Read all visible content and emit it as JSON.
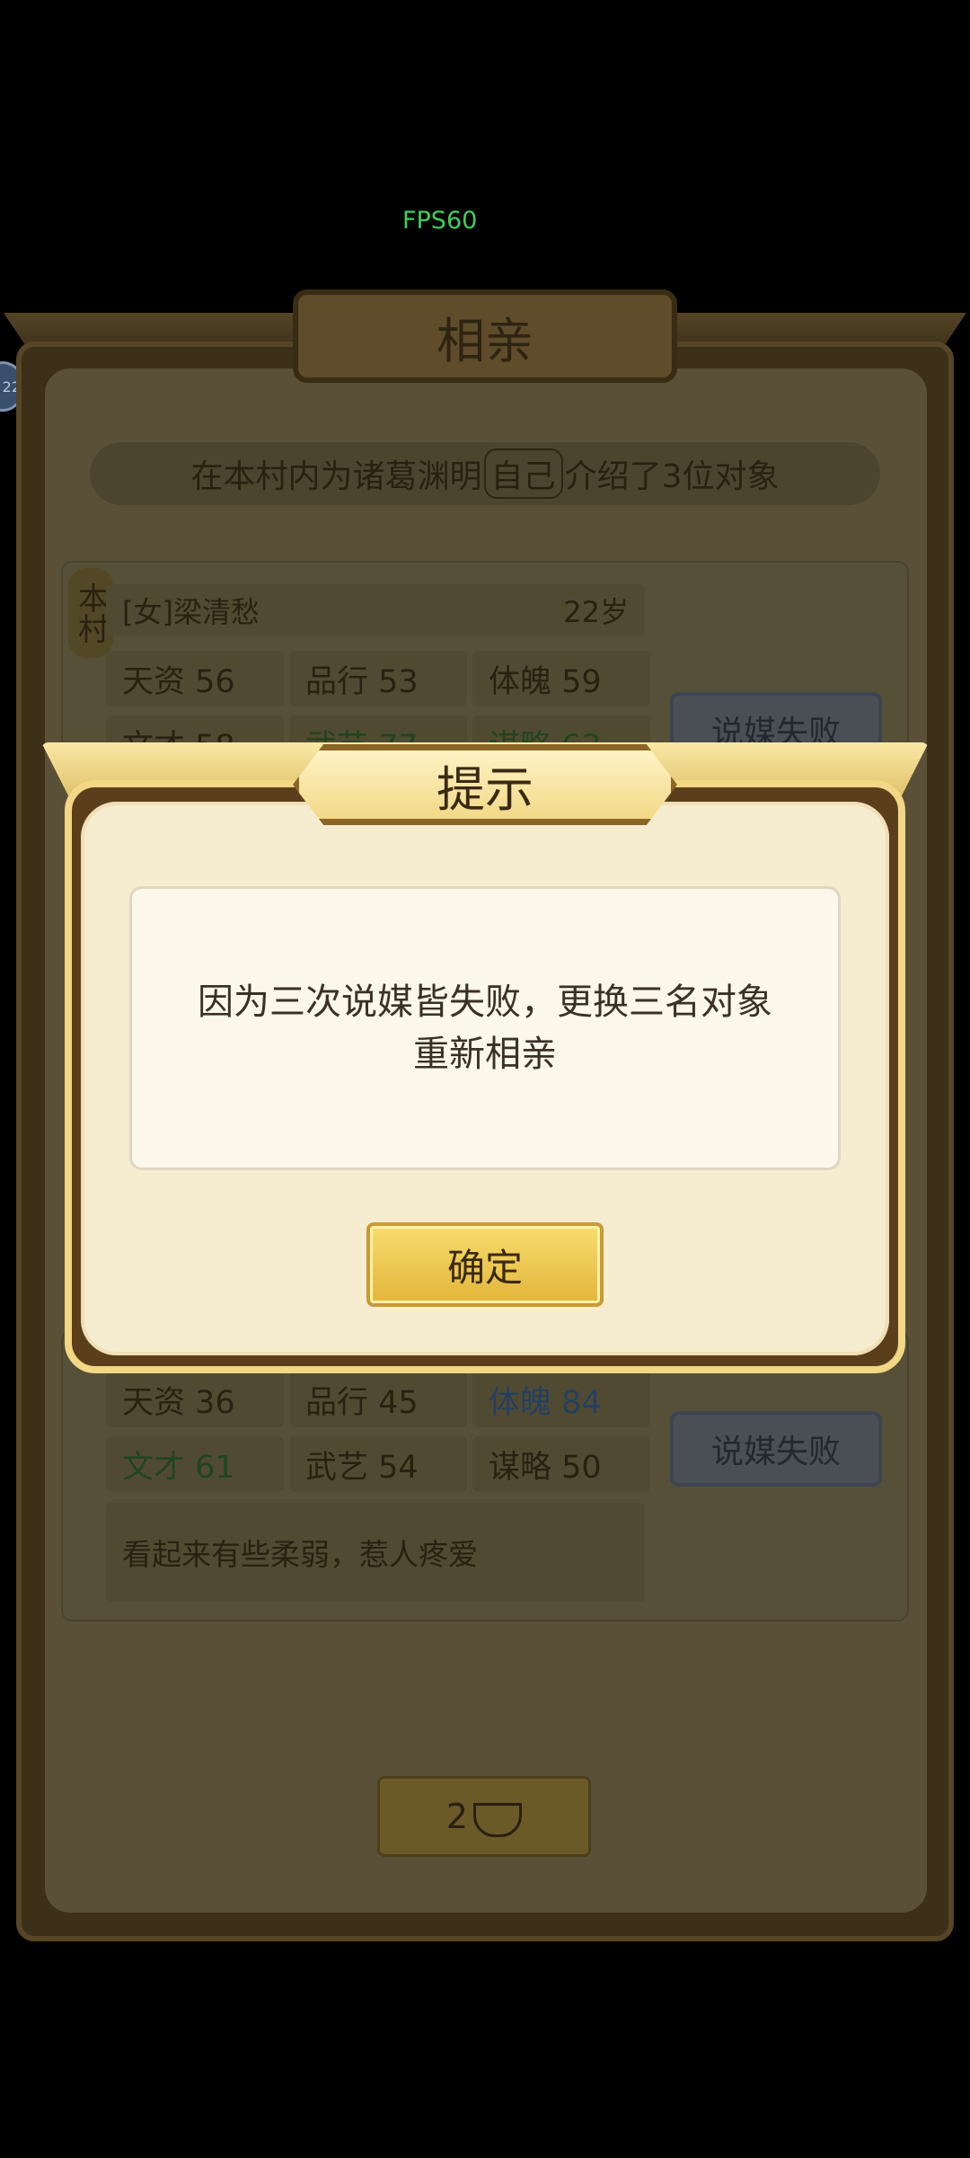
{
  "fps": "FPS60",
  "side_badge": "22",
  "panel": {
    "title": "相亲",
    "intro_before": "在本村内为诸葛渊明",
    "intro_self": "自己",
    "intro_after": "介绍了3位对象",
    "card1": {
      "tag": "本村",
      "name": "[女]梁清愁",
      "age": "22岁",
      "stats": [
        "天资 56",
        "品行 53",
        "体魄 59",
        "文才 58",
        "武艺 77",
        "谋略 63"
      ],
      "button": "说媒失败"
    },
    "card3": {
      "stats": [
        "天资 36",
        "品行 45",
        "体魄 84",
        "文才 61",
        "武艺 54",
        "谋略 50"
      ],
      "description": "看起来有些柔弱，惹人疼爱",
      "button": "说媒失败"
    },
    "cost": "2"
  },
  "modal": {
    "title": "提示",
    "message_line1": "因为三次说媒皆失败，更换三名对象",
    "message_line2": "重新相亲",
    "confirm": "确定"
  },
  "colors": {
    "fps": "#3fcf5a",
    "stat_green": "#2a6a24",
    "stat_blue": "#2c4a6e"
  }
}
